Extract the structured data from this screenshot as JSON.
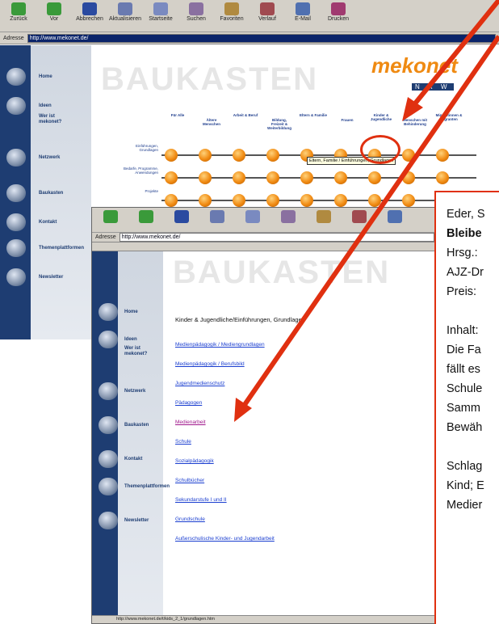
{
  "back_window": {
    "toolbar": [
      "Zurück",
      "Vor",
      "Abbrechen",
      "Aktualisieren",
      "Startseite",
      "Suchen",
      "Favoriten",
      "Verlauf",
      "E-Mail",
      "Drucken"
    ],
    "address_label": "Adresse",
    "address_value": "http://www.mekonet.de/",
    "logo": "mekonet",
    "logo_tag": "N R W",
    "title": "BAUKASTEN",
    "col_heads": [
      "Für Alle",
      "Ältere Menschen",
      "Arbeit & Beruf",
      "Bildung, Freizeit & Weiterbildung",
      "Eltern & Familie",
      "Frauen",
      "Kinder & Jugendliche",
      "Menschen mit Behinderung",
      "Migrantinnen & Migranten"
    ],
    "row_heads": [
      "Einführungen, Grundlagen",
      "Bedarfe, Programme, Anwendungen",
      "Projekte"
    ],
    "tooltip": "Eltern, Familie / Einführungen, Grundlagen",
    "sidebar": [
      "Home",
      "Ideen",
      "Wer ist mekonet?",
      "Netzwerk",
      "Baukasten",
      "Kontakt",
      "Themenplattformen",
      "Newsletter"
    ]
  },
  "front_window": {
    "address_label": "Adresse",
    "address_value": "http://www.mekonet.de/",
    "title": "BAUKASTEN",
    "heading": "Kinder & Jugendliche/Einführungen, Grundlagen",
    "links": [
      "Medienpädagogik / Mediengrundlagen",
      "Medienpädagogik / Berufsbild",
      "Jugendmedienschutz",
      "Pädagogen",
      "Medienarbeit",
      "Schule",
      "Sozialpädagogik",
      "Schulbücher",
      "Sekundarstufe I und II",
      "Grundschule",
      "Außerschulische Kinder- und Jugendarbeit"
    ],
    "sidebar": [
      "Home",
      "Ideen",
      "Wer ist mekonet?",
      "Netzwerk",
      "Baukasten",
      "Kontakt",
      "Themenplattformen",
      "Newsletter"
    ],
    "status": "http://www.mekonet.de/t/kids_2_1/grundlagen.htm"
  },
  "popup": {
    "lines": [
      "Eder, S",
      "Bleibe",
      "Hrsg.:",
      "AJZ-Dr",
      "Preis: ",
      "",
      "Inhalt:",
      "Die Fa",
      "fällt es",
      "Schule",
      "Samm",
      "Bewäh",
      "",
      "Schlag",
      "Kind; E",
      "Medier"
    ]
  },
  "colors": {
    "accent": "#e03010",
    "sidebar": "#1e3d72",
    "logo": "#ef8a12"
  }
}
